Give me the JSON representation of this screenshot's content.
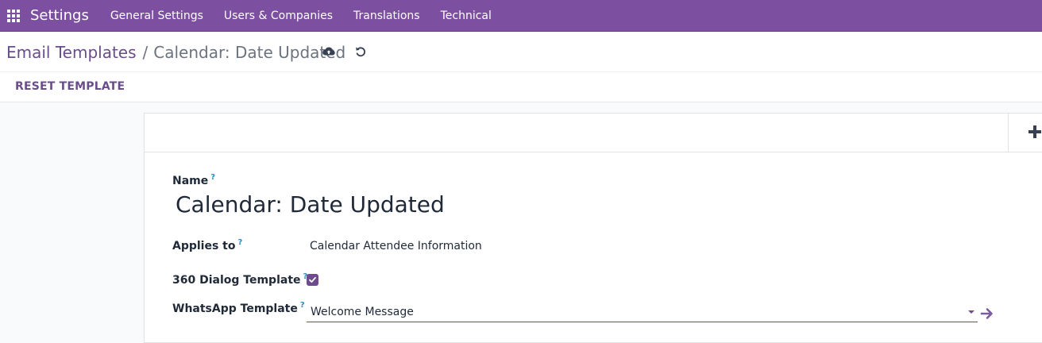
{
  "navbar": {
    "app_title": "Settings",
    "menu": [
      "General Settings",
      "Users & Companies",
      "Translations",
      "Technical"
    ]
  },
  "breadcrumb": {
    "parent": "Email Templates",
    "separator": "/",
    "current": "Calendar: Date Updated"
  },
  "actions": {
    "reset_template": "RESET TEMPLATE"
  },
  "form": {
    "name_label": "Name",
    "name_value": "Calendar: Date Updated",
    "applies_to_label": "Applies to",
    "applies_to_value": "Calendar Attendee Information",
    "dialog360_label": "360 Dialog Template",
    "dialog360_checked": true,
    "whatsapp_label": "WhatsApp Template",
    "whatsapp_value": "Welcome Message",
    "help_mark": "?"
  },
  "colors": {
    "navbar": "#7c4fa0",
    "accent": "#6a4c8c",
    "help": "#2b8cc4"
  }
}
